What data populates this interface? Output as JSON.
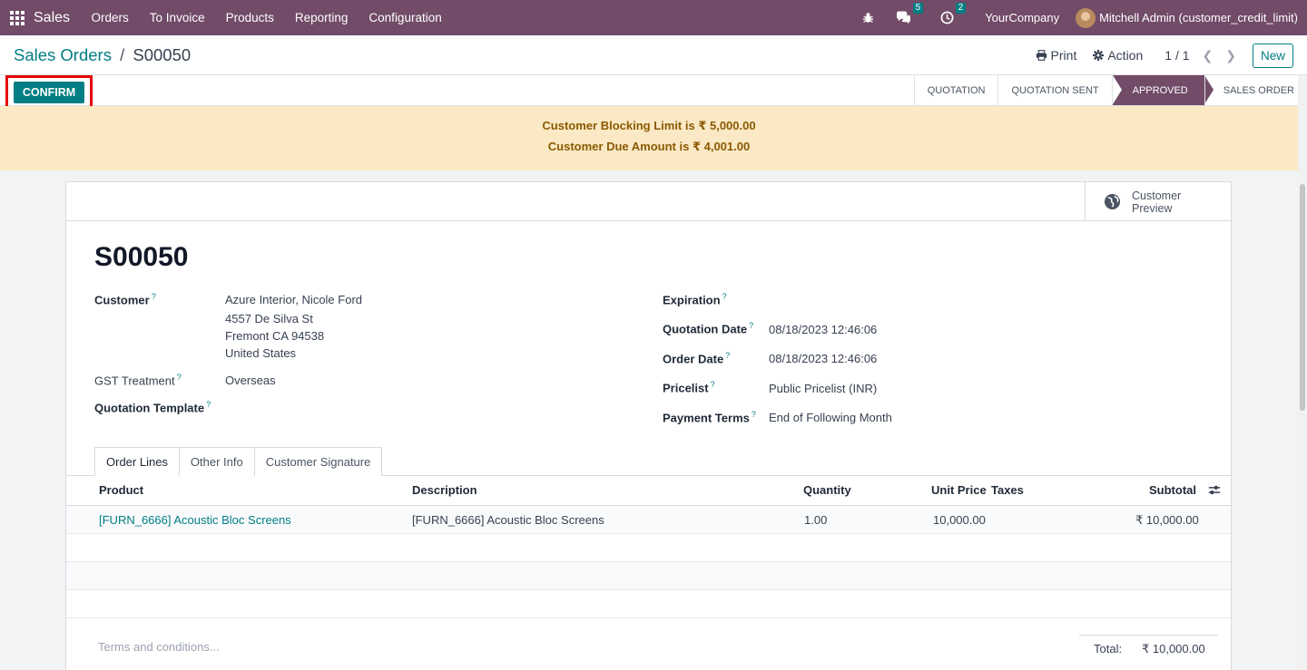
{
  "navbar": {
    "app_name": "Sales",
    "menu": [
      "Orders",
      "To Invoice",
      "Products",
      "Reporting",
      "Configuration"
    ],
    "messages_count": "5",
    "activities_count": "2",
    "company": "YourCompany",
    "user": "Mitchell Admin (customer_credit_limit)"
  },
  "breadcrumb": {
    "parent": "Sales Orders",
    "separator": "/",
    "current": "S00050"
  },
  "control": {
    "print": "Print",
    "action": "Action",
    "pager": "1 / 1",
    "new_label": "New"
  },
  "statusbar": {
    "confirm_label": "CONFIRM",
    "stages": [
      "QUOTATION",
      "QUOTATION SENT",
      "APPROVED",
      "SALES ORDER"
    ],
    "active_stage": "APPROVED"
  },
  "alert": {
    "line1": "Customer Blocking Limit is ₹ 5,000.00",
    "line2": "Customer Due Amount is ₹ 4,001.00"
  },
  "smart_button": {
    "line1": "Customer",
    "line2": "Preview"
  },
  "form": {
    "title": "S00050",
    "customer_label": "Customer",
    "customer_name": "Azure Interior, Nicole Ford",
    "customer_street": "4557 De Silva St",
    "customer_city": "Fremont CA 94538",
    "customer_country": "United States",
    "gst_label": "GST Treatment",
    "gst_value": "Overseas",
    "template_label": "Quotation Template",
    "expiration_label": "Expiration",
    "quotation_date_label": "Quotation Date",
    "quotation_date": "08/18/2023 12:46:06",
    "order_date_label": "Order Date",
    "order_date": "08/18/2023 12:46:06",
    "pricelist_label": "Pricelist",
    "pricelist": "Public Pricelist (INR)",
    "payment_terms_label": "Payment Terms",
    "payment_terms": "End of Following Month",
    "help_mark": "?"
  },
  "tabs": [
    "Order Lines",
    "Other Info",
    "Customer Signature"
  ],
  "table": {
    "headers": {
      "product": "Product",
      "description": "Description",
      "quantity": "Quantity",
      "unit_price": "Unit Price",
      "taxes": "Taxes",
      "subtotal": "Subtotal"
    },
    "rows": [
      {
        "product": "[FURN_6666] Acoustic Bloc Screens",
        "description": "[FURN_6666] Acoustic Bloc Screens",
        "quantity": "1.00",
        "unit_price": "10,000.00",
        "subtotal": "₹ 10,000.00"
      }
    ]
  },
  "footer": {
    "terms_placeholder": "Terms and conditions...",
    "total_label": "Total:",
    "total_value": "₹ 10,000.00"
  },
  "colors": {
    "brand": "#714b67",
    "accent": "#017e84",
    "alert_bg": "#fbe9c6",
    "highlight": "#e50000"
  }
}
